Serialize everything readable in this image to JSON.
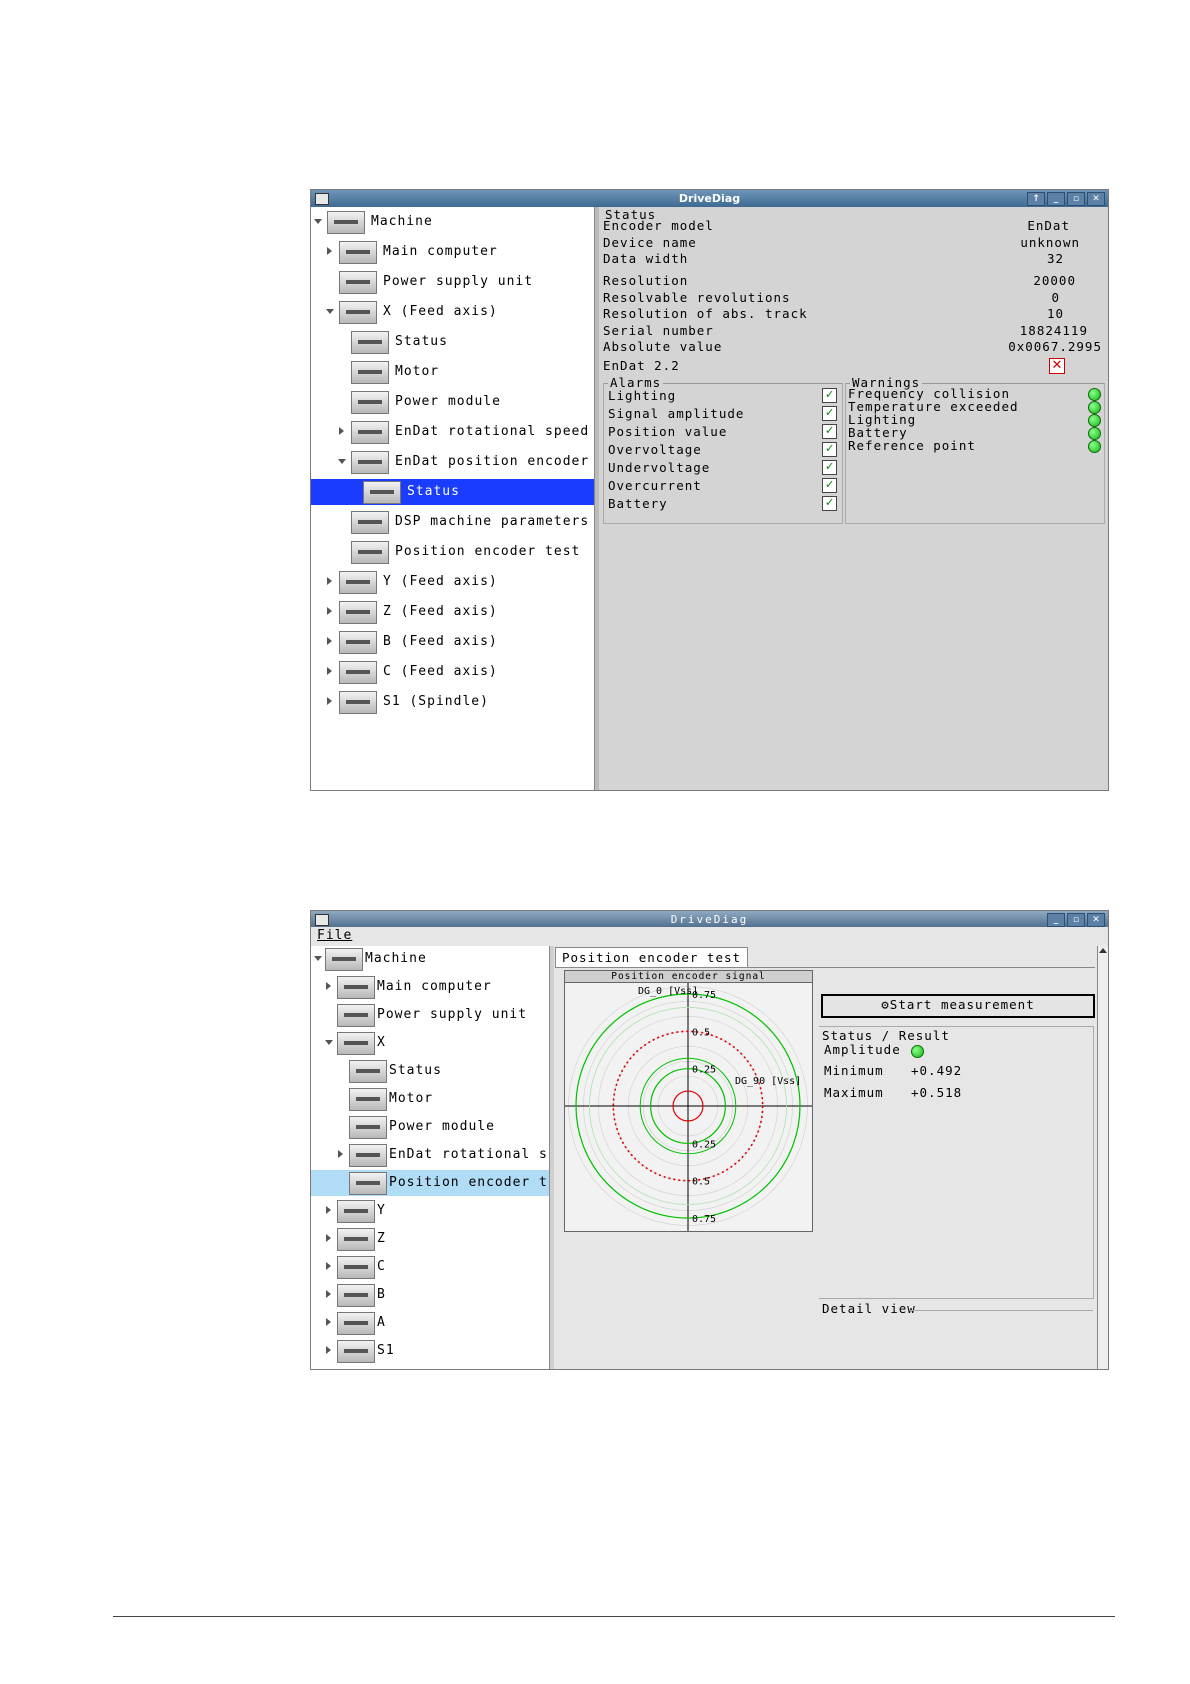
{
  "window1": {
    "title": "DriveDiag",
    "tree": [
      {
        "label": "Machine"
      },
      {
        "label": "Main computer"
      },
      {
        "label": "Power supply unit"
      },
      {
        "label": "X (Feed axis)"
      },
      {
        "label": "Status"
      },
      {
        "label": "Motor"
      },
      {
        "label": "Power module"
      },
      {
        "label": "EnDat rotational speed"
      },
      {
        "label": "EnDat position encoder"
      },
      {
        "label": "Status"
      },
      {
        "label": "DSP machine parameters"
      },
      {
        "label": "Position encoder test"
      },
      {
        "label": "Y (Feed axis)"
      },
      {
        "label": "Z (Feed axis)"
      },
      {
        "label": "B (Feed axis)"
      },
      {
        "label": "C (Feed axis)"
      },
      {
        "label": "S1 (Spindle)"
      }
    ],
    "status_title": "Status",
    "fields": [
      {
        "label": "Encoder model",
        "value": "EnDat"
      },
      {
        "label": "Device name",
        "value": "unknown"
      },
      {
        "label": "Data width",
        "value": "32"
      },
      {
        "label": "Resolution",
        "value": "20000"
      },
      {
        "label": "Resolvable revolutions",
        "value": "0"
      },
      {
        "label": "Resolution of abs. track",
        "value": "10"
      },
      {
        "label": "Serial number",
        "value": "18824119"
      },
      {
        "label": "Absolute value",
        "value": "0x0067.2995"
      }
    ],
    "endat_label": "EnDat 2.2",
    "alarms_title": "Alarms",
    "alarms": [
      "Lighting",
      "Signal amplitude",
      "Position value",
      "Overvoltage",
      "Undervoltage",
      "Overcurrent",
      "Battery"
    ],
    "warnings_title": "Warnings",
    "warnings": [
      "Frequency collision",
      "Temperature exceeded",
      "Lighting",
      "Battery",
      "Reference point"
    ]
  },
  "window2": {
    "title": "DriveDiag",
    "menu_file": "File",
    "tree": [
      {
        "label": "Machine"
      },
      {
        "label": "Main computer"
      },
      {
        "label": "Power supply unit"
      },
      {
        "label": "X"
      },
      {
        "label": "Status"
      },
      {
        "label": "Motor"
      },
      {
        "label": "Power module"
      },
      {
        "label": "EnDat rotational s"
      },
      {
        "label": "Position encoder t"
      },
      {
        "label": "Y"
      },
      {
        "label": "Z"
      },
      {
        "label": "C"
      },
      {
        "label": "B"
      },
      {
        "label": "A"
      },
      {
        "label": "S1"
      }
    ],
    "tab_label": "Position encoder test",
    "plot_title": "Position encoder signal",
    "start_button": "Start measurement",
    "status_result": "Status / Result",
    "amplitude_label": "Amplitude",
    "minimum_label": "Minimum",
    "minimum_value": "+0.492",
    "maximum_label": "Maximum",
    "maximum_value": "+0.518",
    "detail_view": "Detail view"
  },
  "chart_data": {
    "type": "scatter",
    "title": "Position encoder signal",
    "xlabel": "DG_90 [Vss]",
    "ylabel": "DG_0 [Vss]",
    "xlim": [
      -0.75,
      0.75
    ],
    "ylim": [
      -0.75,
      0.75
    ],
    "y_ticks": [
      "0.75",
      "0.5",
      "0.25",
      "0.25",
      "0.5",
      "0.75"
    ],
    "reference_circles_radii": [
      0.1,
      0.25,
      0.75
    ],
    "series": [
      {
        "values": [
          {
            "shape": "circle",
            "radius": 0.5
          }
        ]
      }
    ],
    "colors": {
      "reference": "#00c000",
      "signal": "#e00000",
      "inner": "#e00000"
    }
  }
}
